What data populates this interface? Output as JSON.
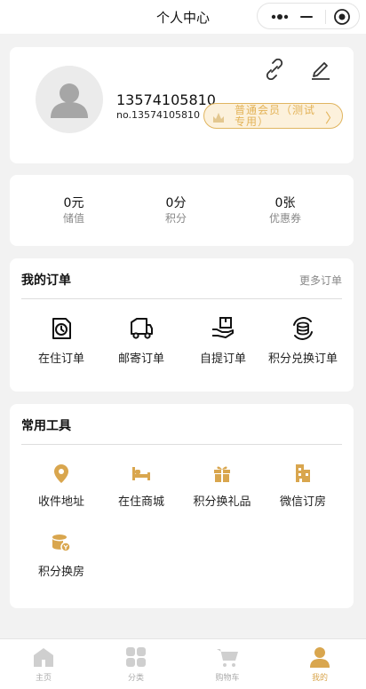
{
  "header": {
    "title": "个人中心",
    "capsule": {
      "more_icon": "more-dots-icon",
      "minimize_icon": "minimize-icon",
      "close_icon": "target-circle-icon"
    }
  },
  "profile": {
    "avatar_icon": "user-avatar-icon",
    "phone": "13574105810",
    "member_no": "no.13574105810",
    "link_icon": "link-icon",
    "edit_icon": "edit-pen-icon",
    "membership": {
      "label": "普通会员（测试专用）",
      "icon": "crown-hand-icon",
      "chevron": "〉"
    }
  },
  "stats": [
    {
      "value": "0元",
      "label": "储值"
    },
    {
      "value": "0分",
      "label": "积分"
    },
    {
      "value": "0张",
      "label": "优惠券"
    }
  ],
  "orders": {
    "title": "我的订单",
    "more": "更多订单",
    "items": [
      {
        "label": "在住订单",
        "icon": "clock-doc-icon"
      },
      {
        "label": "邮寄订单",
        "icon": "delivery-truck-icon"
      },
      {
        "label": "自提订单",
        "icon": "package-hand-icon"
      },
      {
        "label": "积分兑换订单",
        "icon": "coin-exchange-icon"
      }
    ]
  },
  "tools": {
    "title": "常用工具",
    "items": [
      {
        "label": "收件地址",
        "icon": "location-pin-icon"
      },
      {
        "label": "在住商城",
        "icon": "bed-icon"
      },
      {
        "label": "积分换礼品",
        "icon": "gift-icon"
      },
      {
        "label": "微信订房",
        "icon": "building-icon"
      },
      {
        "label": "积分换房",
        "icon": "coin-stack-icon"
      }
    ]
  },
  "tabbar": {
    "items": [
      {
        "label": "主页",
        "icon": "home-icon",
        "active": false
      },
      {
        "label": "分类",
        "icon": "grid-icon",
        "active": false
      },
      {
        "label": "购物车",
        "icon": "cart-icon",
        "active": false
      },
      {
        "label": "我的",
        "icon": "person-icon",
        "active": true
      }
    ]
  },
  "colors": {
    "accent": "#d9a64e",
    "badge_bg": "#fcf1dc",
    "page_bg": "#f2f2f2",
    "inactive": "#cfcfcf"
  }
}
